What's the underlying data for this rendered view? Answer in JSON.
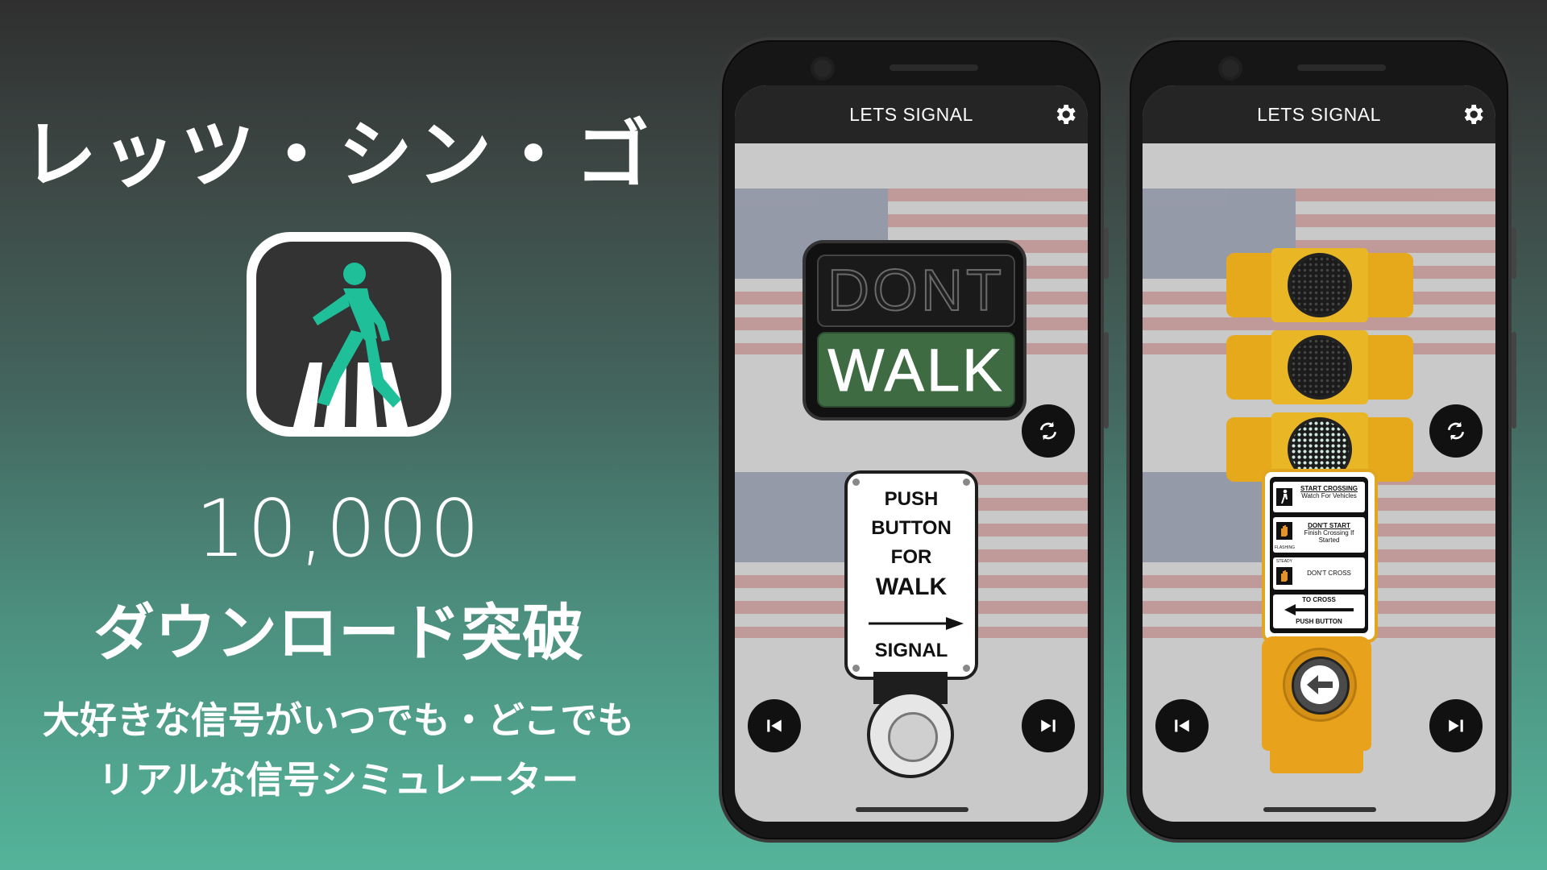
{
  "promo": {
    "app_title": "レッツ・シン・ゴー",
    "download_count": "10,000",
    "download_label": "ダウンロード突破",
    "tagline_line1": "大好きな信号がいつでも・どこでも",
    "tagline_line2": "リアルな信号シミュレーター",
    "icon_name": "pedestrian-crossing-icon",
    "accent_color": "#1fbf9a"
  },
  "phone1": {
    "header_title": "LETS SIGNAL",
    "signal_top": "DONT",
    "signal_bottom": "WALK",
    "push_sign": {
      "line1": "PUSH",
      "line2": "BUTTON",
      "line3": "FOR",
      "line4": "WALK",
      "line5": "SIGNAL"
    },
    "icons": {
      "settings": "gear-icon",
      "refresh": "refresh-icon",
      "prev": "skip-previous-icon",
      "next": "skip-next-icon"
    }
  },
  "phone2": {
    "header_title": "LETS SIGNAL",
    "ped_sign": {
      "row1_title": "START CROSSING",
      "row1_text": "Watch For Vehicles",
      "row2_title": "DON'T START",
      "row2_text": "Finish Crossing If Started",
      "row2_tag": "FLASHING",
      "row3_tag": "STEADY",
      "row3_title": "DON'T CROSS",
      "row4_title": "TO CROSS",
      "row4_text": "PUSH BUTTON"
    },
    "traffic_light_active": "bottom",
    "icons": {
      "settings": "gear-icon",
      "refresh": "refresh-icon",
      "prev": "skip-previous-icon",
      "next": "skip-next-icon"
    }
  }
}
